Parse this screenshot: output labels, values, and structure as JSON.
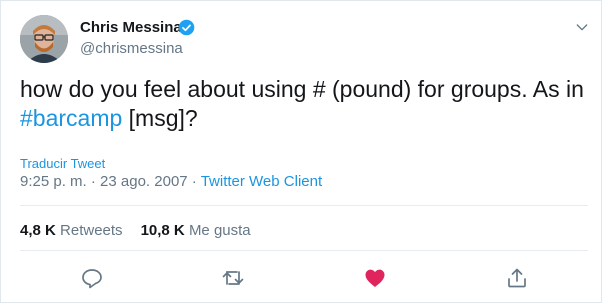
{
  "author": {
    "name": "Chris Messina",
    "handle": "@chrismessina"
  },
  "tweet": {
    "text_before": "how do you feel about using # (pound) for groups. As in ",
    "hashtag": "#barcamp",
    "text_after": " [msg]?"
  },
  "translate_label": "Traducir Tweet",
  "meta": {
    "time": "9:25 p. m.",
    "separator": " · ",
    "date": "23 ago. 2007",
    "client": "Twitter Web Client"
  },
  "stats": {
    "retweets_count": "4,8 K",
    "retweets_label": "Retweets",
    "likes_count": "10,8 K",
    "likes_label": "Me gusta"
  },
  "colors": {
    "accent": "#1b95e0",
    "like": "#e0245e",
    "muted": "#657786"
  },
  "icons": [
    "verified-badge-icon",
    "chevron-down-icon",
    "reply-icon",
    "retweet-icon",
    "heart-icon",
    "share-icon"
  ]
}
